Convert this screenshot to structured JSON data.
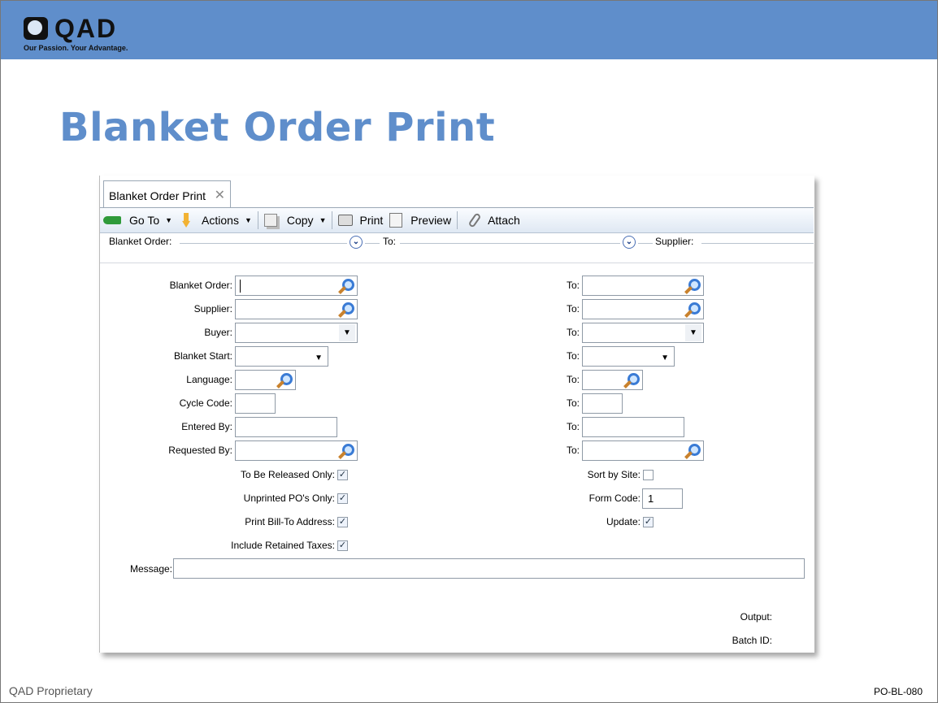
{
  "brand": {
    "name": "QAD",
    "tagline": "Our Passion. Your Advantage."
  },
  "slide": {
    "title": "Blanket Order Print",
    "footer_left": "QAD Proprietary",
    "footer_right": "PO-BL-080"
  },
  "app": {
    "tab_label": "Blanket Order Print",
    "toolbar": {
      "goto": "Go To",
      "actions": "Actions",
      "copy": "Copy",
      "print": "Print",
      "preview": "Preview",
      "attach": "Attach"
    },
    "filter": {
      "blanket_order": "Blanket Order:",
      "to": "To:",
      "supplier": "Supplier:"
    },
    "form": {
      "blanket_order": "Blanket Order:",
      "supplier": "Supplier:",
      "buyer": "Buyer:",
      "blanket_start": "Blanket Start:",
      "language": "Language:",
      "cycle_code": "Cycle Code:",
      "entered_by": "Entered By:",
      "requested_by": "Requested By:",
      "to": "To:",
      "to_be_released_only": "To Be Released Only:",
      "unprinted_pos_only": "Unprinted PO's Only:",
      "print_bill_to_address": "Print Bill-To Address:",
      "include_retained_taxes": "Include Retained Taxes:",
      "sort_by_site": "Sort by Site:",
      "form_code": "Form Code:",
      "form_code_value": "1",
      "update": "Update:",
      "message": "Message:",
      "output": "Output:",
      "batch_id": "Batch ID:",
      "checks": {
        "to_be_released_only": true,
        "unprinted_pos_only": true,
        "print_bill_to_address": true,
        "include_retained_taxes": true,
        "sort_by_site": false,
        "update": true
      }
    }
  }
}
